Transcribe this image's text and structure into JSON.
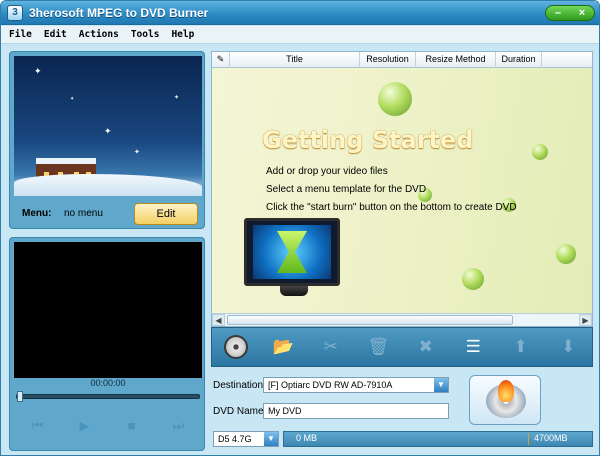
{
  "window": {
    "title": "3herosoft MPEG to DVD Burner",
    "minimize": "–",
    "close": "×"
  },
  "menubar": [
    "File",
    "Edit",
    "Actions",
    "Tools",
    "Help"
  ],
  "preview": {
    "menu_label": "Menu:",
    "menu_value": "no menu",
    "edit_label": "Edit"
  },
  "player": {
    "time": "00:00:00",
    "progress": 0
  },
  "list": {
    "columns": [
      "",
      "Title",
      "Resolution",
      "Resize Method",
      "Duration"
    ],
    "getting_started": {
      "title": "Getting Started",
      "lines": [
        "Add or drop your video files",
        "Select a menu template for the DVD",
        "Click the \"start burn\" button on the bottom to create DVD"
      ]
    }
  },
  "toolbar": [
    "film-reel-icon",
    "add-file-icon",
    "edit-video-icon",
    "delete-icon",
    "clear-icon",
    "menu-list-icon",
    "move-up-icon",
    "move-down-icon"
  ],
  "destination": {
    "label": "Destination:",
    "value": "[F] Optiarc DVD RW AD-7910A"
  },
  "dvd_name": {
    "label": "DVD Name:",
    "value": "My DVD"
  },
  "disc": {
    "type": "D5 4.7G",
    "used": "0 MB",
    "total": "4700MB"
  }
}
